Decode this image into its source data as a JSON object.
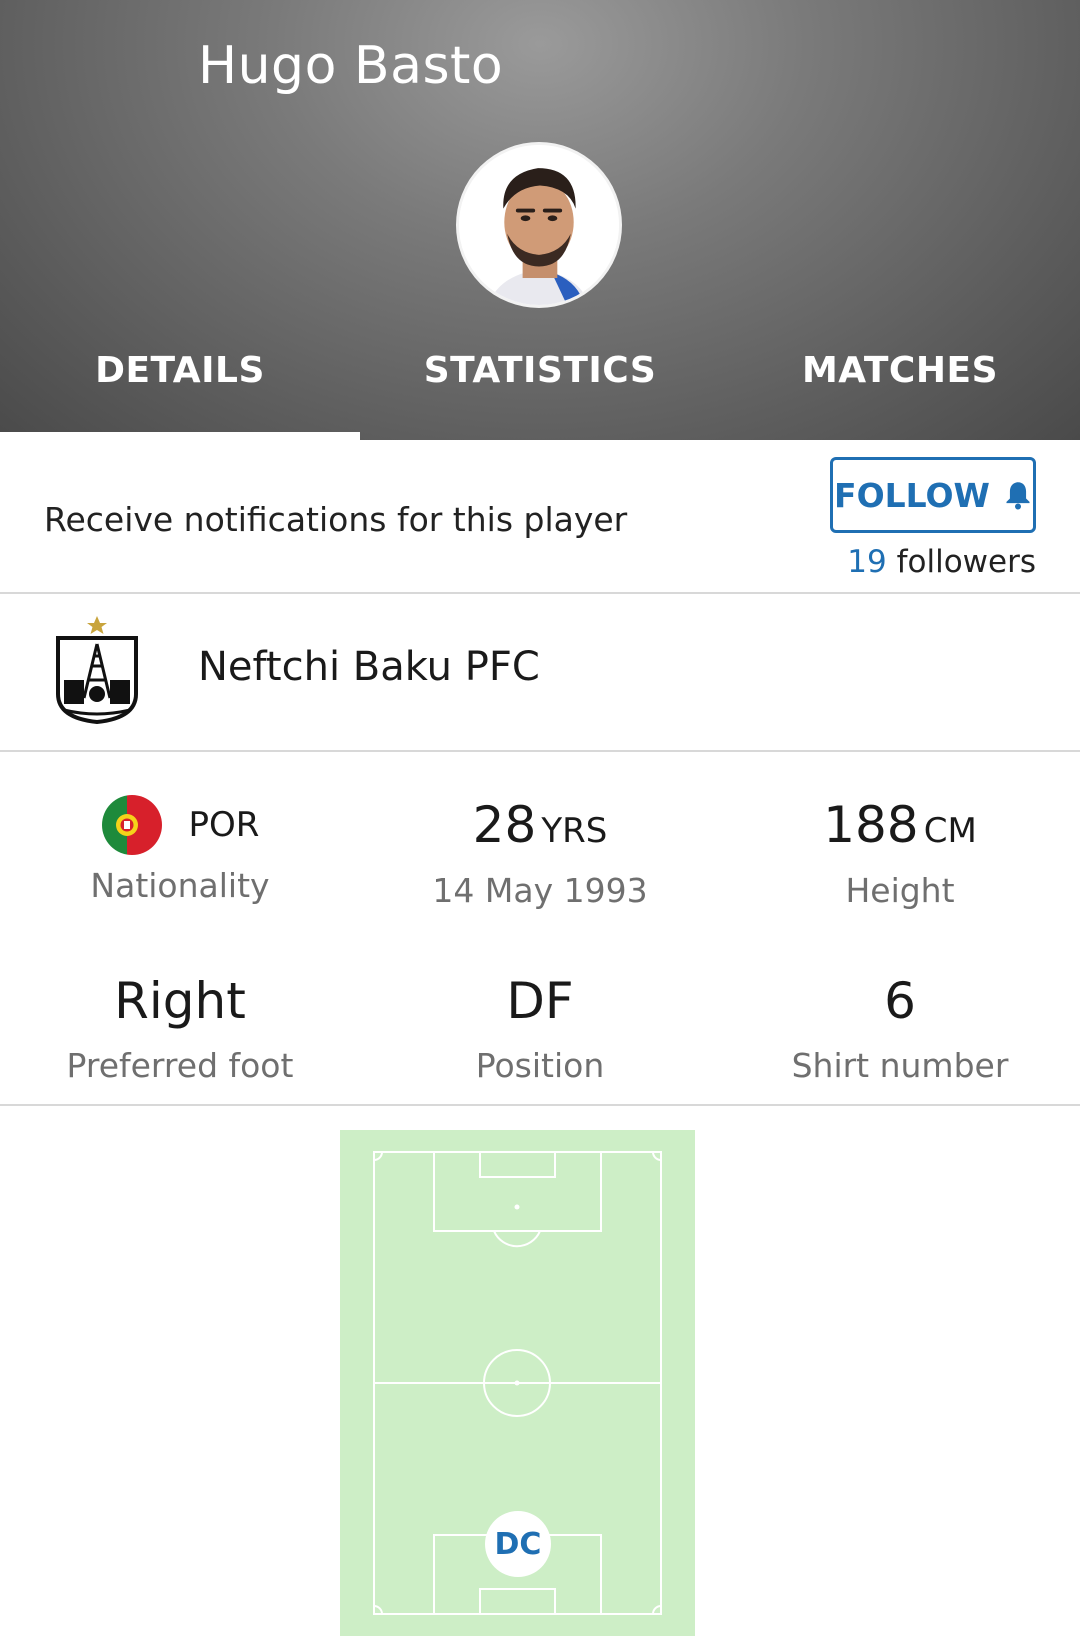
{
  "header": {
    "player_name": "Hugo Basto",
    "tabs": [
      {
        "label": "DETAILS",
        "active": true
      },
      {
        "label": "STATISTICS",
        "active": false
      },
      {
        "label": "MATCHES",
        "active": false
      }
    ]
  },
  "follow": {
    "notify_text": "Receive notifications for this player",
    "button_label": "FOLLOW",
    "button_icon": "bell-icon",
    "followers_count": "19",
    "followers_label": "followers",
    "accent_color": "#1f6fb3"
  },
  "club": {
    "name": "Neftchi Baku PFC",
    "logo_icon": "club-crest-icon"
  },
  "stats": {
    "nationality": {
      "code": "POR",
      "label": "Nationality",
      "flag_icon": "portugal-flag-icon"
    },
    "age": {
      "value": "28",
      "unit": "YRS",
      "label": "14 May 1993"
    },
    "height": {
      "value": "188",
      "unit": "CM",
      "label": "Height"
    },
    "foot": {
      "value": "Right",
      "label": "Preferred foot"
    },
    "position": {
      "value": "DF",
      "label": "Position"
    },
    "shirt": {
      "value": "6",
      "label": "Shirt number"
    }
  },
  "pitch": {
    "position_badge": "DC",
    "pitch_color": "#cdeec6"
  }
}
